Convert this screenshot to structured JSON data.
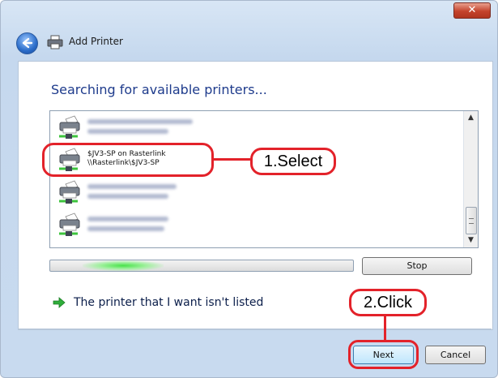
{
  "window": {
    "close_icon": "✕",
    "title": "Add Printer",
    "heading": "Searching for available printers..."
  },
  "printers": [
    {
      "name": "",
      "path": "",
      "blurred": true
    },
    {
      "name": "$JV3-SP on Rasterlink",
      "path": "\\\\Rasterlink\\$JV3-SP",
      "blurred": false
    },
    {
      "name": "",
      "path": "",
      "blurred": true
    },
    {
      "name": "",
      "path": "",
      "blurred": true
    }
  ],
  "scrollbar": {
    "up_icon": "▲",
    "down_icon": "▼"
  },
  "progress": {
    "state": "indeterminate"
  },
  "buttons": {
    "stop": "Stop",
    "next": "Next",
    "cancel": "Cancel"
  },
  "link": {
    "text": "The printer that I want isn't listed"
  },
  "annotations": {
    "select": "1.Select",
    "click": "2.Click"
  },
  "colors": {
    "annotation": "#e3222a",
    "heading": "#1e3b8c",
    "next_border": "#3c7fb1",
    "close_red": "#c4432c"
  }
}
